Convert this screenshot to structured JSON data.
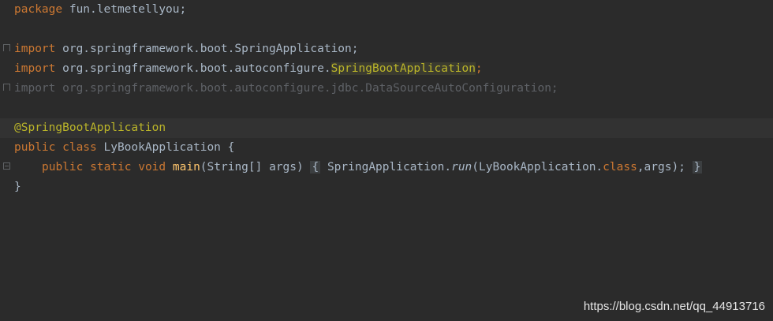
{
  "code": {
    "line1": {
      "kw": "package",
      "rest": " fun.letmetellyou;"
    },
    "line3": {
      "kw": "import",
      "rest": " org.springframework.boot.SpringApplication;"
    },
    "line4": {
      "kw": "import",
      "pre": " org.springframework.boot.autoconfigure.",
      "cls": "SpringBootApplication",
      "semi": ";"
    },
    "line5": {
      "text": "import org.springframework.boot.autoconfigure.jdbc.DataSourceAutoConfiguration;"
    },
    "line7": {
      "annotation": "@SpringBootApplication"
    },
    "line8": {
      "kw": "public class",
      "rest": " LyBookApplication {"
    },
    "line9": {
      "kw": "public static void",
      "method": "main",
      "params": "(String[] args) ",
      "open": "{",
      "call_pre": " SpringApplication.",
      "call_method": "run",
      "call_args_pre": "(LyBookApplication.",
      "call_kw": "class",
      "call_args_post": ",args);",
      "close": "}"
    },
    "line10": {
      "text": "}"
    }
  },
  "watermark": "https://blog.csdn.net/qq_44913716",
  "colors": {
    "background": "#2b2b2b",
    "keyword": "#cc7832",
    "annotation": "#bbb529",
    "method": "#ffc66d",
    "unused": "#5e6166",
    "text": "#a9b7c6"
  }
}
